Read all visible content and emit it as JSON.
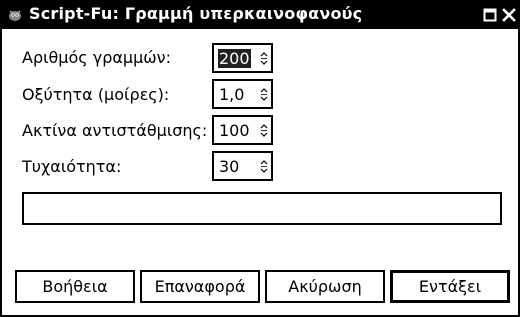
{
  "window": {
    "title": "Script-Fu: Γραμμή υπερκαινοφανούς",
    "icons": [
      "gimp-wilber-icon",
      "maximize-icon",
      "close-icon"
    ]
  },
  "fields": [
    {
      "label": "Αριθμός γραμμών:",
      "value": "200",
      "selected": true
    },
    {
      "label": "Οξύτητα (μοίρες):",
      "value": "1,0"
    },
    {
      "label": "Ακτίνα αντιστάθμισης:",
      "value": "100"
    },
    {
      "label": "Τυχαιότητα:",
      "value": "30"
    }
  ],
  "text_entry": {
    "value": ""
  },
  "buttons": {
    "help": "Βοήθεια",
    "reset": "Επαναφορά",
    "cancel": "Ακύρωση",
    "ok": "Εντάξει"
  },
  "colors": {
    "titlebar": "#000000",
    "selection": "#222222",
    "background": "#ffffff"
  }
}
